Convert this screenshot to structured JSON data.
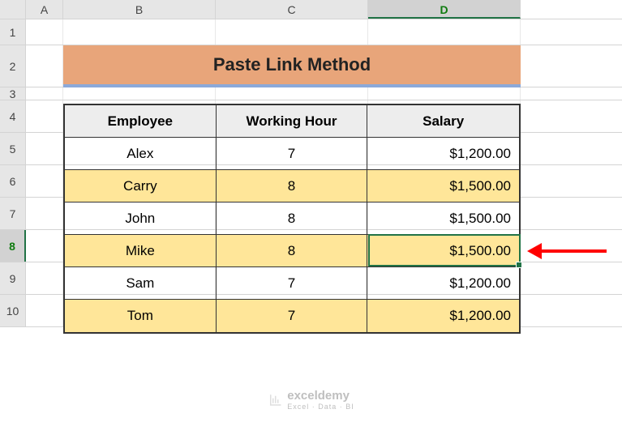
{
  "columns": [
    "A",
    "B",
    "C",
    "D"
  ],
  "rows": [
    "1",
    "2",
    "3",
    "4",
    "5",
    "6",
    "7",
    "8",
    "9",
    "10"
  ],
  "selectedCol": "D",
  "selectedRow": "8",
  "title": "Paste Link Method",
  "table": {
    "headers": [
      "Employee",
      "Working Hour",
      "Salary"
    ],
    "data": [
      {
        "employee": "Alex",
        "hours": "7",
        "salary": "$1,200.00",
        "alt": false
      },
      {
        "employee": "Carry",
        "hours": "8",
        "salary": "$1,500.00",
        "alt": true
      },
      {
        "employee": "John",
        "hours": "8",
        "salary": "$1,500.00",
        "alt": false
      },
      {
        "employee": "Mike",
        "hours": "8",
        "salary": "$1,500.00",
        "alt": true
      },
      {
        "employee": "Sam",
        "hours": "7",
        "salary": "$1,200.00",
        "alt": false
      },
      {
        "employee": "Tom",
        "hours": "7",
        "salary": "$1,200.00",
        "alt": true
      }
    ]
  },
  "watermark": {
    "text": "exceldemy",
    "subtitle": "Excel · Data · BI"
  },
  "colors": {
    "accent": "#e8a57a",
    "accentBorder": "#8ca9d9",
    "altRow": "#ffe699",
    "selection": "#217346"
  }
}
